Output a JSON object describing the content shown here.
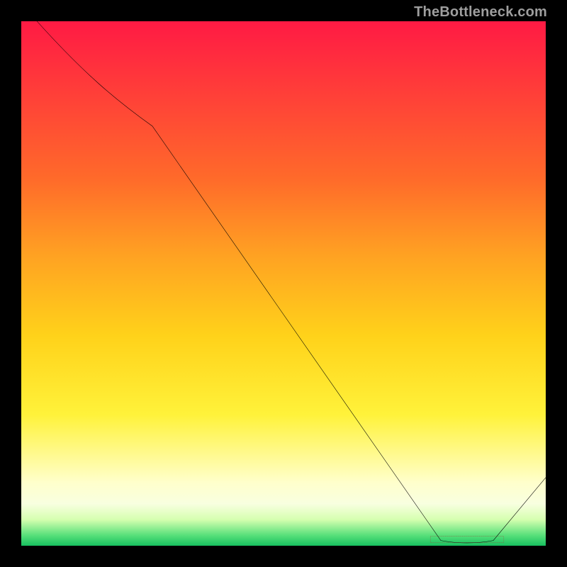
{
  "watermark": "TheBottleneck.com",
  "bottom_label": "",
  "chart_data": {
    "type": "line",
    "title": "",
    "xlabel": "",
    "ylabel": "",
    "xlim": [
      0,
      100
    ],
    "ylim": [
      0,
      100
    ],
    "series": [
      {
        "name": "curve",
        "x": [
          3,
          25,
          80,
          90,
          100
        ],
        "values": [
          100,
          80,
          1,
          1,
          13
        ]
      }
    ],
    "optimum_x_range": [
      78,
      92
    ],
    "gradient_stops": [
      {
        "pos": 0,
        "color": "#ff1a44"
      },
      {
        "pos": 12,
        "color": "#ff3a3a"
      },
      {
        "pos": 30,
        "color": "#ff6a2a"
      },
      {
        "pos": 45,
        "color": "#ffa322"
      },
      {
        "pos": 60,
        "color": "#ffd21a"
      },
      {
        "pos": 75,
        "color": "#fff23a"
      },
      {
        "pos": 88,
        "color": "#ffffcc"
      },
      {
        "pos": 92,
        "color": "#f8ffe0"
      },
      {
        "pos": 95,
        "color": "#d6ffb0"
      },
      {
        "pos": 98,
        "color": "#58e07a"
      },
      {
        "pos": 100,
        "color": "#18c060"
      }
    ]
  }
}
